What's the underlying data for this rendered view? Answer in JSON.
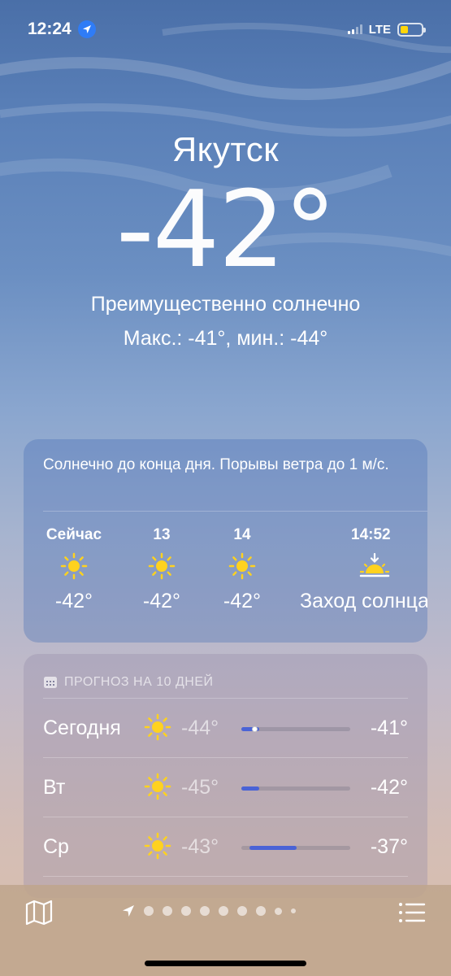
{
  "status_bar": {
    "time": "12:24",
    "network": "LTE",
    "battery_level": 0.3,
    "accent_location": "#2f7cf6",
    "accent_battery": "#ffd60a"
  },
  "header": {
    "city": "Якутск",
    "temperature": "-42°",
    "condition": "Преимущественно солнечно",
    "hi_lo": "Макс.: -41°, мин.: -44°"
  },
  "hourly": {
    "summary": "Солнечно до конца дня. Порывы ветра до 1 м/с.",
    "items": [
      {
        "label": "Сейчас",
        "icon": "sun-icon",
        "value": "-42°"
      },
      {
        "label": "13",
        "icon": "sun-icon",
        "value": "-42°"
      },
      {
        "label": "14",
        "icon": "sun-icon",
        "value": "-42°"
      },
      {
        "label": "14:52",
        "icon": "sunset-icon",
        "value": "Заход солнца"
      }
    ]
  },
  "daily": {
    "title": "ПРОГНОЗ НА 10 ДНЕЙ",
    "icon": "calendar-icon",
    "bar_color": "#4a63d6",
    "items": [
      {
        "day": "Сегодня",
        "icon": "sun-icon",
        "low": "-44°",
        "high": "-41°"
      },
      {
        "day": "Вт",
        "icon": "sun-icon",
        "low": "-45°",
        "high": "-42°"
      },
      {
        "day": "Ср",
        "icon": "sun-icon",
        "low": "-43°",
        "high": "-37°"
      }
    ]
  },
  "bottom_bar": {
    "left_icon": "map-icon",
    "right_icon": "list-icon",
    "location_icon": "location-arrow-icon",
    "page_dots": 9
  }
}
